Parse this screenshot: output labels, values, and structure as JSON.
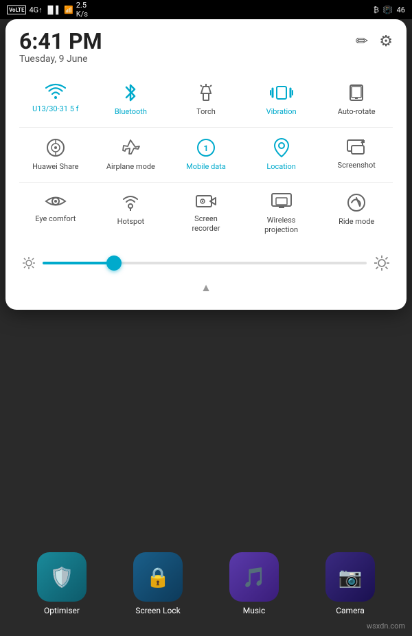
{
  "statusBar": {
    "leftItems": [
      "VoLTE",
      "4G",
      "signal",
      "wifi",
      "2.5 K/s"
    ],
    "rightItems": [
      "bluetooth",
      "vibrate",
      "battery_46"
    ]
  },
  "time": "6:41 PM",
  "date": "Tuesday, 9 June",
  "headerIcons": {
    "edit": "✏",
    "settings": "⚙"
  },
  "toggles": [
    {
      "id": "wifi",
      "label": "U13/30-31 5 f",
      "active": true
    },
    {
      "id": "bluetooth",
      "label": "Bluetooth",
      "active": true
    },
    {
      "id": "torch",
      "label": "Torch",
      "active": false
    },
    {
      "id": "vibration",
      "label": "Vibration",
      "active": true
    },
    {
      "id": "autorotate",
      "label": "Auto-rotate",
      "active": false
    },
    {
      "id": "huaweishare",
      "label": "Huawei Share",
      "active": false
    },
    {
      "id": "airplanemode",
      "label": "Airplane mode",
      "active": false
    },
    {
      "id": "mobiledata",
      "label": "Mobile data",
      "active": true
    },
    {
      "id": "location",
      "label": "Location",
      "active": true
    },
    {
      "id": "screenshot",
      "label": "Screenshot",
      "active": false
    },
    {
      "id": "eyecomfort",
      "label": "Eye comfort",
      "active": false
    },
    {
      "id": "hotspot",
      "label": "Hotspot",
      "active": false
    },
    {
      "id": "screenrecorder",
      "label": "Screen\nrecorder",
      "active": false
    },
    {
      "id": "wirelessprojection",
      "label": "Wireless\nprojection",
      "active": false
    },
    {
      "id": "ridemode",
      "label": "Ride mode",
      "active": false
    }
  ],
  "brightness": {
    "value": 22,
    "minIcon": "☀",
    "maxIcon": "☀"
  },
  "apps": [
    {
      "id": "optimiser",
      "label": "Optimiser",
      "color": "#1a6b7a",
      "icon": "🛡"
    },
    {
      "id": "screenlock",
      "label": "Screen Lock",
      "color": "#1a4f6b",
      "icon": "🔒"
    },
    {
      "id": "music",
      "label": "Music",
      "color": "#4a2d8f",
      "icon": "🎵"
    },
    {
      "id": "camera",
      "label": "Camera",
      "color": "#2d2060",
      "icon": "📷"
    }
  ],
  "watermark": "wsxdn.com"
}
